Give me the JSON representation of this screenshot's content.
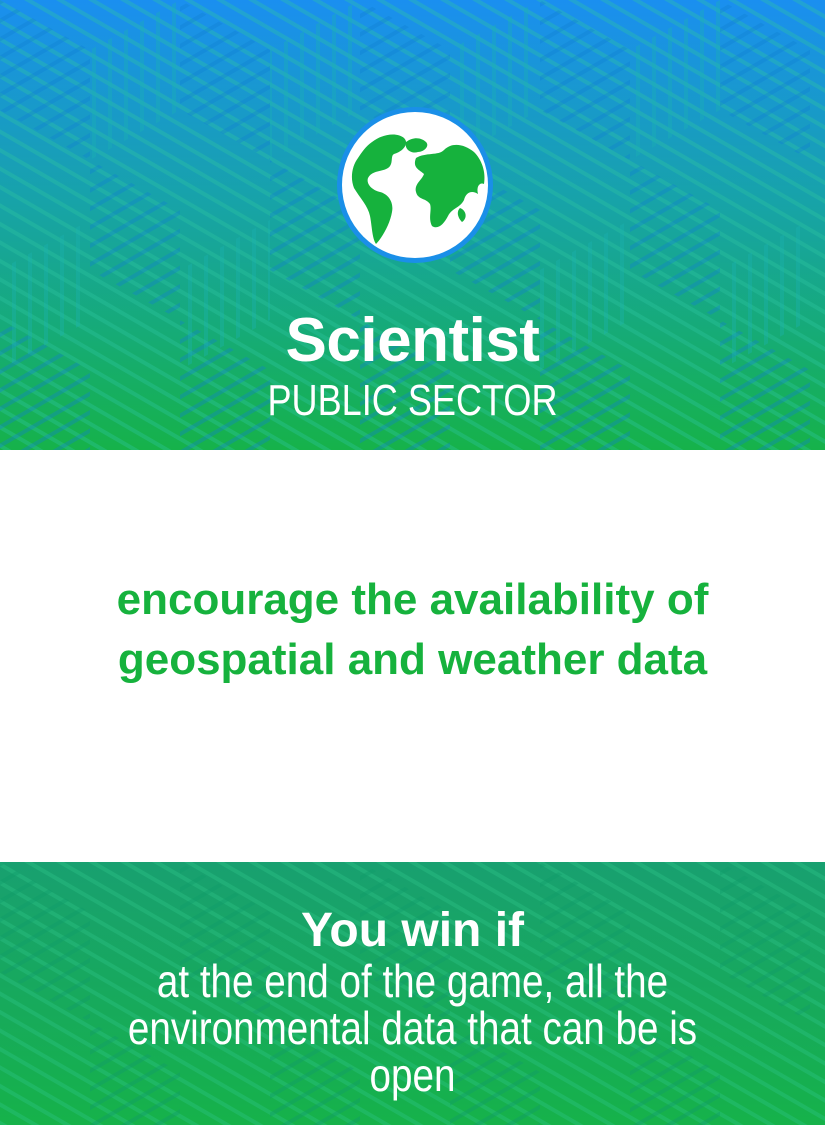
{
  "card": {
    "role": "Scientist",
    "sector": "PUBLIC SECTOR",
    "icon": "globe-icon",
    "goal": "encourage the availability of geospatial and weather data",
    "win_title": "You win if",
    "win_condition": "at the end of the game, all the environmental data that can be is open"
  },
  "colors": {
    "header_top": "#1a8ff0",
    "header_bottom": "#16b24a",
    "accent_green": "#16b23d",
    "globe_ring": "#1a8fe8",
    "text_white": "#ffffff"
  }
}
